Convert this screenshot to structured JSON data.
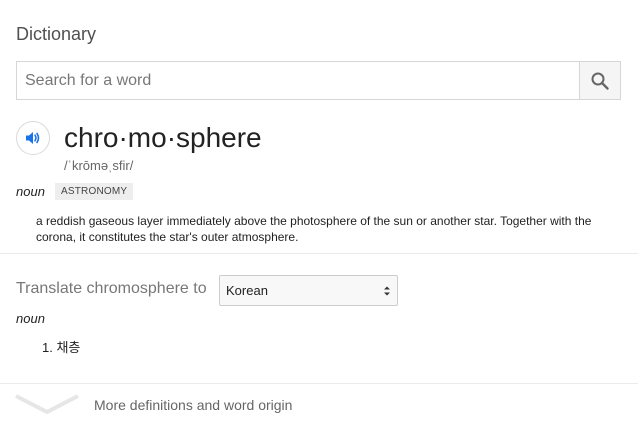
{
  "header": {
    "title": "Dictionary"
  },
  "search": {
    "placeholder": "Search for a word",
    "value": ""
  },
  "entry": {
    "word": "chro·mo·sphere",
    "phonetic": "/ˈkrōməˌsfir/",
    "part_of_speech": "noun",
    "domain_badge": "ASTRONOMY",
    "definition": "a reddish gaseous layer immediately above the photosphere of the sun or another star. Together with the corona, it constitutes the star's outer atmosphere."
  },
  "translate": {
    "label": "Translate chromosphere to",
    "selected_language": "Korean",
    "part_of_speech": "noun",
    "results": [
      "1. 채층"
    ]
  },
  "footer": {
    "more_link": "More definitions and word origin"
  },
  "icons": {
    "search": "search-icon",
    "speaker": "speaker-icon",
    "select_caret": "select-caret-icon",
    "expand": "chevron-down-icon"
  },
  "colors": {
    "accent": "#1a73e8",
    "muted": "#777777",
    "badge_bg": "#eeeeee"
  }
}
